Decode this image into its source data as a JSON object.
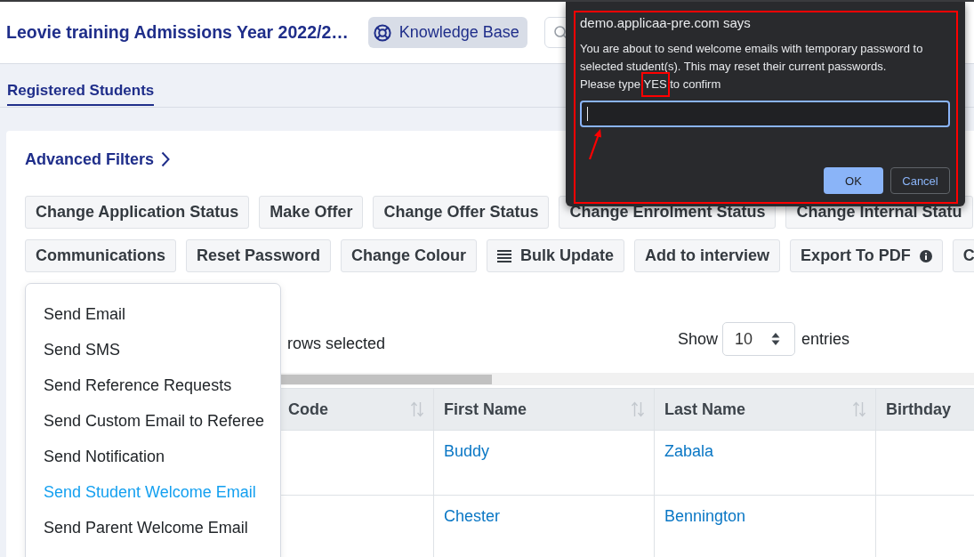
{
  "header": {
    "title": "Leovie training Admissions Year 2022/2…",
    "knowledge_base_button": "Knowledge Base"
  },
  "tabs": [
    {
      "label": "Registered Students",
      "selected": true
    }
  ],
  "advanced_filters": "Advanced Filters",
  "action_rows": [
    {
      "buttons": [
        {
          "label": "Change Application Status",
          "kind": "plain"
        },
        {
          "label": "Make Offer",
          "kind": "plain"
        },
        {
          "label": "Change Offer Status",
          "kind": "plain"
        },
        {
          "label": "Change Enrolment Status",
          "kind": "plain"
        },
        {
          "label": "Change Internal Statu",
          "kind": "plain"
        }
      ]
    },
    {
      "buttons": [
        {
          "label": "Communications",
          "kind": "plain"
        },
        {
          "label": "Reset Password",
          "kind": "plain"
        },
        {
          "label": "Change Colour",
          "kind": "plain"
        },
        {
          "label": "Bulk Update",
          "kind": "leading_icon"
        },
        {
          "label": "Add to interview",
          "kind": "plain"
        },
        {
          "label": "Export To PDF",
          "kind": "trailing_icon"
        },
        {
          "label": "C",
          "kind": "plain"
        }
      ]
    }
  ],
  "communications_menu": {
    "items": [
      {
        "label": "Send Email",
        "selected": false
      },
      {
        "label": "Send SMS",
        "selected": false
      },
      {
        "label": "Send Reference Requests",
        "selected": false
      },
      {
        "label": "Send Custom Email to Referee",
        "selected": false
      },
      {
        "label": "Send Notification",
        "selected": false
      },
      {
        "label": "Send Student Welcome Email",
        "selected": true
      },
      {
        "label": "Send Parent Welcome Email",
        "selected": false
      }
    ]
  },
  "selection_info": "rows selected",
  "page_length": {
    "label": "Show",
    "value": "10",
    "suffix": "entries"
  },
  "table": {
    "columns": [
      {
        "label": "Code"
      },
      {
        "label": "First Name"
      },
      {
        "label": "Last Name"
      },
      {
        "label": "Birthday"
      }
    ],
    "rows": [
      {
        "first_name": "Buddy",
        "last_name": "Zabala"
      },
      {
        "first_name": "Chester",
        "last_name": "Bennington"
      }
    ]
  },
  "dialog": {
    "origin": "demo.applicaa-pre.com says",
    "message": "You are about to send welcome emails with temporary password to selected student(s). This may reset their current passwords.",
    "prompt": {
      "before": "Please type",
      "marked": "YES",
      "after": "to confirm"
    },
    "buttons": [
      {
        "label": "OK",
        "kind": "primary"
      },
      {
        "label": "Cancel",
        "kind": "secondary"
      }
    ]
  }
}
